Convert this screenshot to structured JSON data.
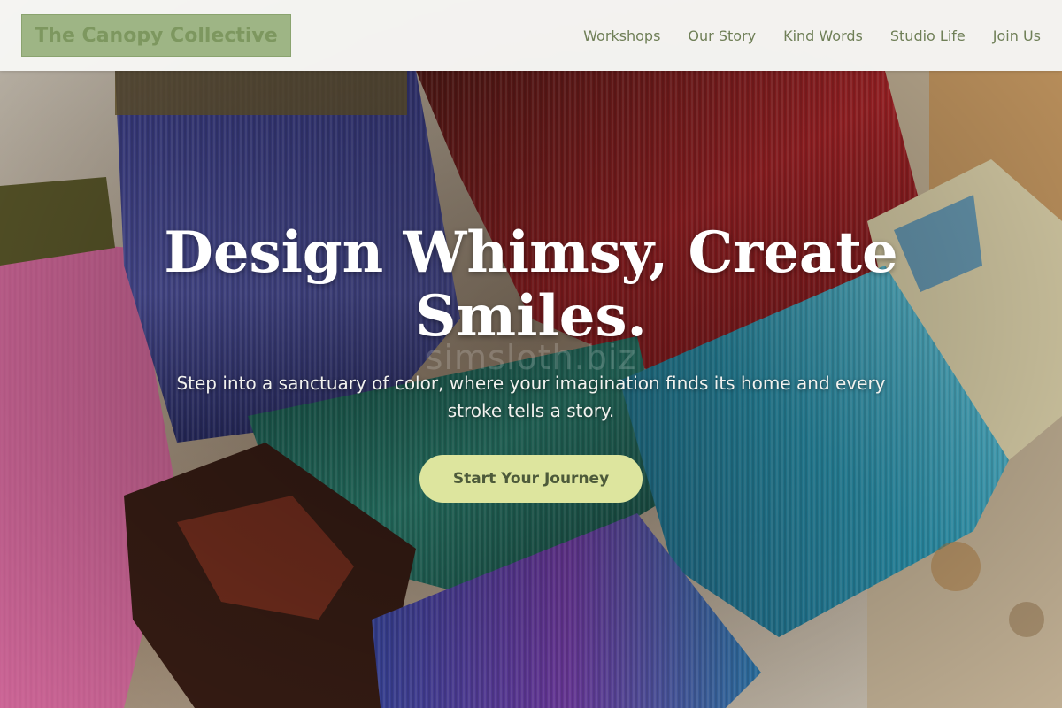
{
  "header": {
    "logo_text": "The Canopy Collective",
    "nav": [
      {
        "label": "Workshops"
      },
      {
        "label": "Our Story"
      },
      {
        "label": "Kind Words"
      },
      {
        "label": "Studio Life"
      },
      {
        "label": "Join Us"
      }
    ]
  },
  "hero": {
    "title": "Design Whimsy, Create Smiles.",
    "subtitle": "Step into a sanctuary of color, where your imagination finds its home and every stroke tells a story.",
    "cta_label": "Start Your Journey",
    "watermark": "simsloth.biz",
    "background_icon": "paint-brushes-photo"
  },
  "colors": {
    "logo_bg": "#9eb585",
    "logo_text": "#7d975f",
    "nav_text": "#6f7f57",
    "cta_bg": "#dde59e",
    "cta_text": "#4d5a3a",
    "header_bg": "#f7f7f5"
  }
}
